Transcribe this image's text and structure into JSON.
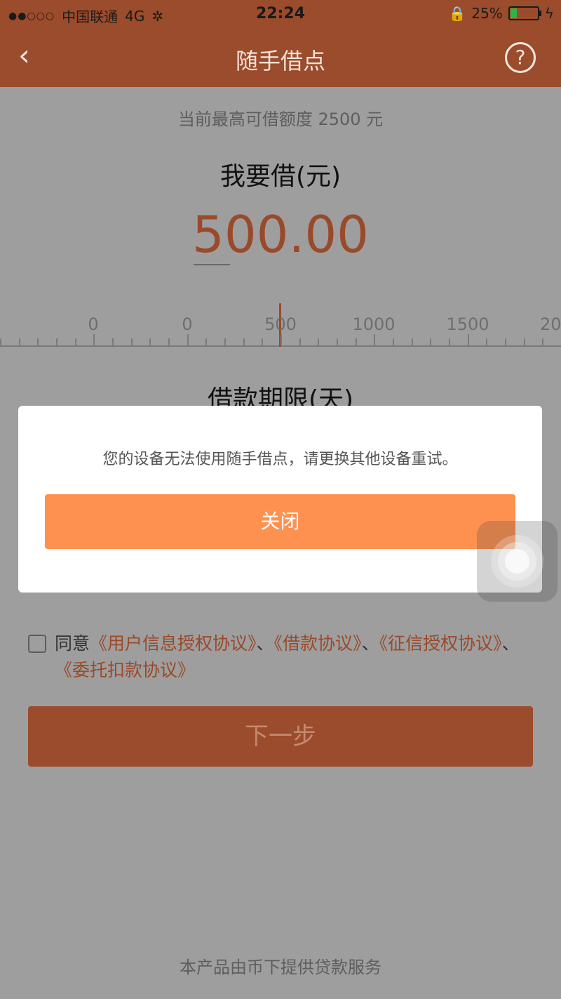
{
  "status_bar": {
    "signal_dots": "●●○○○",
    "carrier": "中国联通",
    "network": "4G",
    "time": "22:24",
    "battery_percent": "25%",
    "battery_level": 0.25,
    "battery_color": "#2fb344"
  },
  "nav": {
    "back_icon": "‹",
    "title": "随手借点",
    "help_icon": "?"
  },
  "loan": {
    "max_credit_text": "当前最高可借额度 2500 元",
    "borrow_label": "我要借(元)",
    "amount": "500.00",
    "slider": {
      "labels": [
        "0",
        "0",
        "500",
        "1000",
        "1500",
        "20"
      ],
      "selected_value": 500
    },
    "term_label": "借款期限(天)"
  },
  "agreement": {
    "prefix": "同意",
    "link1": "《用户信息授权协议》",
    "sep1": "、",
    "link2": "《借款协议》",
    "sep2": "、",
    "link3": "《征信授权协议》",
    "sep3": "、",
    "link4": "《委托扣款协议》"
  },
  "next_button": "下一步",
  "footer": "本产品由币下提供贷款服务",
  "modal": {
    "message": "您的设备无法使用随手借点，请更换其他设备重试。",
    "close_label": "关闭"
  },
  "colors": {
    "brand": "#9b4c2c",
    "accent": "#ff9150"
  }
}
